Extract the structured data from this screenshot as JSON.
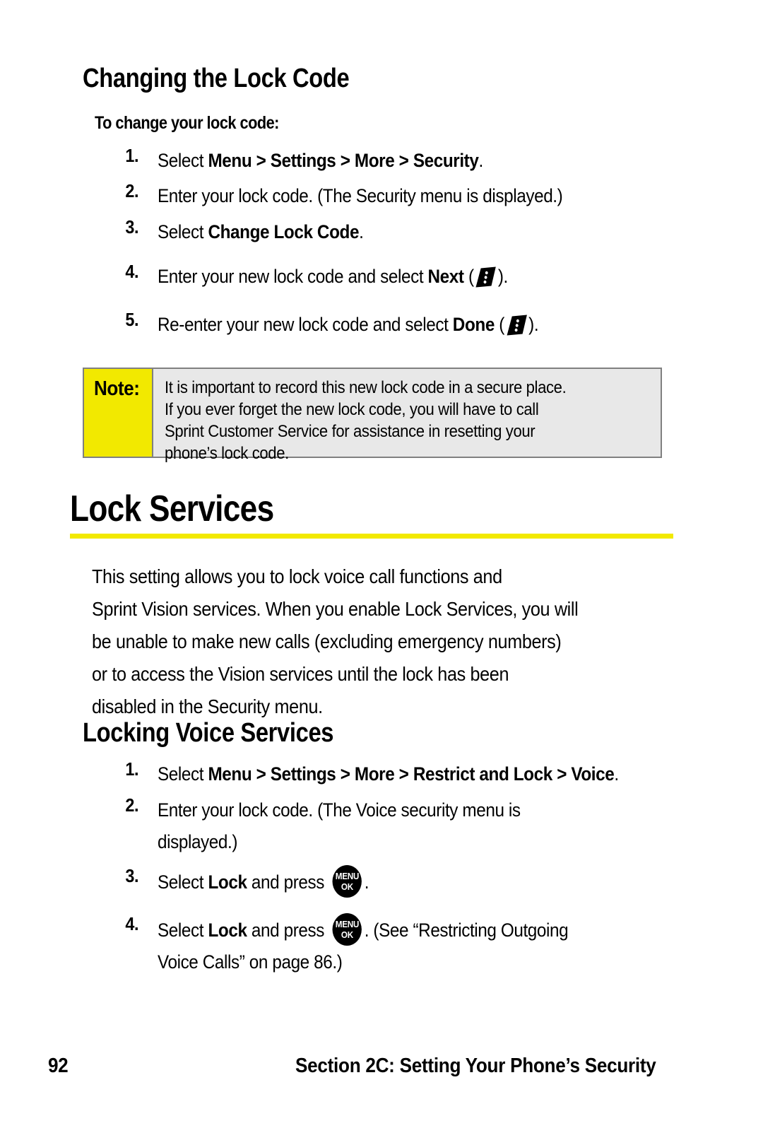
{
  "page": {
    "number": "92",
    "footer_title": "Section 2C: Setting Your Phone’s Security"
  },
  "section_change_lock_code": {
    "heading": "Changing the Lock Code",
    "lead": "To change your lock code:",
    "steps": [
      {
        "num": "1.",
        "parts": [
          {
            "t": "Select ",
            "b": false
          },
          {
            "t": "Menu",
            "b": true
          },
          {
            "t": " > ",
            "b": true
          },
          {
            "t": "Settings",
            "b": true
          },
          {
            "t": " > ",
            "b": true
          },
          {
            "t": "More",
            "b": true
          },
          {
            "t": " > ",
            "b": true
          },
          {
            "t": "Security",
            "b": true
          },
          {
            "t": ".",
            "b": false
          }
        ]
      },
      {
        "num": "2.",
        "parts": [
          {
            "t": "Enter your lock code. (The Security menu is displayed.)",
            "b": false
          }
        ]
      },
      {
        "num": "3.",
        "parts": [
          {
            "t": "Select ",
            "b": false
          },
          {
            "t": "Change Lock Code",
            "b": true
          },
          {
            "t": ".",
            "b": false
          }
        ]
      },
      {
        "num": "4.",
        "parts": [
          {
            "t": "Enter your new lock code and select ",
            "b": false
          },
          {
            "t": "Next",
            "b": true
          },
          {
            "t": " (",
            "b": false
          },
          {
            "icon": "softkey-right-icon"
          },
          {
            "t": ").",
            "b": false
          }
        ]
      },
      {
        "num": "5.",
        "parts": [
          {
            "t": "Re-enter your new lock code and select ",
            "b": false
          },
          {
            "t": "Done",
            "b": true
          },
          {
            "t": " (",
            "b": false
          },
          {
            "icon": "softkey-right-icon"
          },
          {
            "t": ").",
            "b": false
          }
        ]
      }
    ],
    "note": {
      "label": "Note:",
      "lines": [
        "It is important to record this new lock code in a secure place.",
        "If you ever forget the new lock code, you will have to call",
        "Sprint Customer Service for assistance in resetting your",
        "phone’s lock code."
      ]
    }
  },
  "section_lock_services": {
    "heading": "Lock Services",
    "paragraph_lines": [
      "This setting allows you to lock voice call functions and",
      "Sprint Vision services. When you enable Lock Services, you will",
      "be unable to make new calls (excluding emergency numbers)",
      "or to access the Vision services until the lock has been",
      "disabled in the Security menu."
    ],
    "subheading": "Locking Voice Services",
    "steps": [
      {
        "num": "1.",
        "parts": [
          {
            "t": "Select ",
            "b": false
          },
          {
            "t": "Menu",
            "b": true
          },
          {
            "t": " > ",
            "b": true
          },
          {
            "t": "Settings",
            "b": true
          },
          {
            "t": " > ",
            "b": true
          },
          {
            "t": "More",
            "b": true
          },
          {
            "t": " > ",
            "b": true
          },
          {
            "t": "Restrict and Lock",
            "b": true
          },
          {
            "t": " > ",
            "b": true
          },
          {
            "t": "Voice",
            "b": true
          },
          {
            "t": ".",
            "b": false
          }
        ]
      },
      {
        "num": "2.",
        "parts": [
          {
            "t": "Enter your lock code. (The Voice security menu is",
            "b": false
          },
          {
            "br": true
          },
          {
            "t": "displayed.)",
            "b": false
          }
        ]
      },
      {
        "num": "3.",
        "parts": [
          {
            "t": "Select ",
            "b": false
          },
          {
            "t": "Lock",
            "b": true
          },
          {
            "t": " and press ",
            "b": false
          },
          {
            "icon": "menu-ok-button-icon"
          },
          {
            "t": ".",
            "b": false
          }
        ]
      },
      {
        "num": "4.",
        "parts": [
          {
            "t": "Select ",
            "b": false
          },
          {
            "t": "Lock",
            "b": true
          },
          {
            "t": " and press ",
            "b": false
          },
          {
            "icon": "menu-ok-button-icon"
          },
          {
            "t": ". (See “Restricting Outgoing",
            "b": false
          },
          {
            "br": true
          },
          {
            "t": "Voice Calls” on page 86.)",
            "b": false
          }
        ]
      }
    ]
  },
  "icons": {
    "menu_ok_line1": "MENU",
    "menu_ok_line2": "OK"
  },
  "colors": {
    "accent_yellow": "#F2E900",
    "note_body_gray": "#E8E8E8",
    "note_border_gray": "#808080",
    "text_black": "#000000"
  }
}
